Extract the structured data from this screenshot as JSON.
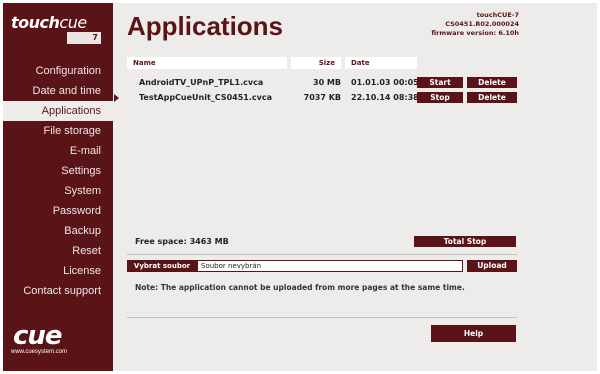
{
  "logo": {
    "word_a": "touch",
    "word_b": "cue",
    "model": "7"
  },
  "header": {
    "title": "Applications",
    "device_name": "touchCUE-7",
    "serial": "CS0451.R02.000024",
    "firmware": "firmware version: 6.10h"
  },
  "sidebar": {
    "items": [
      {
        "label": "Configuration",
        "active": false
      },
      {
        "label": "Date and time",
        "active": false
      },
      {
        "label": "Applications",
        "active": true
      },
      {
        "label": "File storage",
        "active": false
      },
      {
        "label": "E-mail",
        "active": false
      },
      {
        "label": "Settings",
        "active": false
      },
      {
        "label": "System",
        "active": false
      },
      {
        "label": "Password",
        "active": false
      },
      {
        "label": "Backup",
        "active": false
      },
      {
        "label": "Reset",
        "active": false
      },
      {
        "label": "License",
        "active": false
      },
      {
        "label": "Contact support",
        "active": false
      }
    ],
    "brand": "cue",
    "brand_url": "www.cuesystem.com"
  },
  "table": {
    "headers": {
      "name": "Name",
      "size": "Size",
      "date": "Date"
    },
    "rows": [
      {
        "name": "AndroidTV_UPnP_TPL1.cvca",
        "size": "30 MB",
        "date": "01.01.03 00:05",
        "action": "Start",
        "delete": "Delete",
        "selected": false
      },
      {
        "name": "TestAppCueUnit_CS0451.cvca",
        "size": "7037 KB",
        "date": "22.10.14 08:38",
        "action": "Stop",
        "delete": "Delete",
        "selected": true
      }
    ]
  },
  "free_space": "Free space: 3463 MB",
  "total_stop": "Total Stop",
  "upload": {
    "choose_label": "Vybrat soubor",
    "file_value": "Soubor nevybrán",
    "upload_label": "Upload"
  },
  "note": "Note: The application cannot be uploaded from more pages at the same time.",
  "help": "Help",
  "colors": {
    "accent": "#5a1418",
    "background": "#eeecea"
  }
}
